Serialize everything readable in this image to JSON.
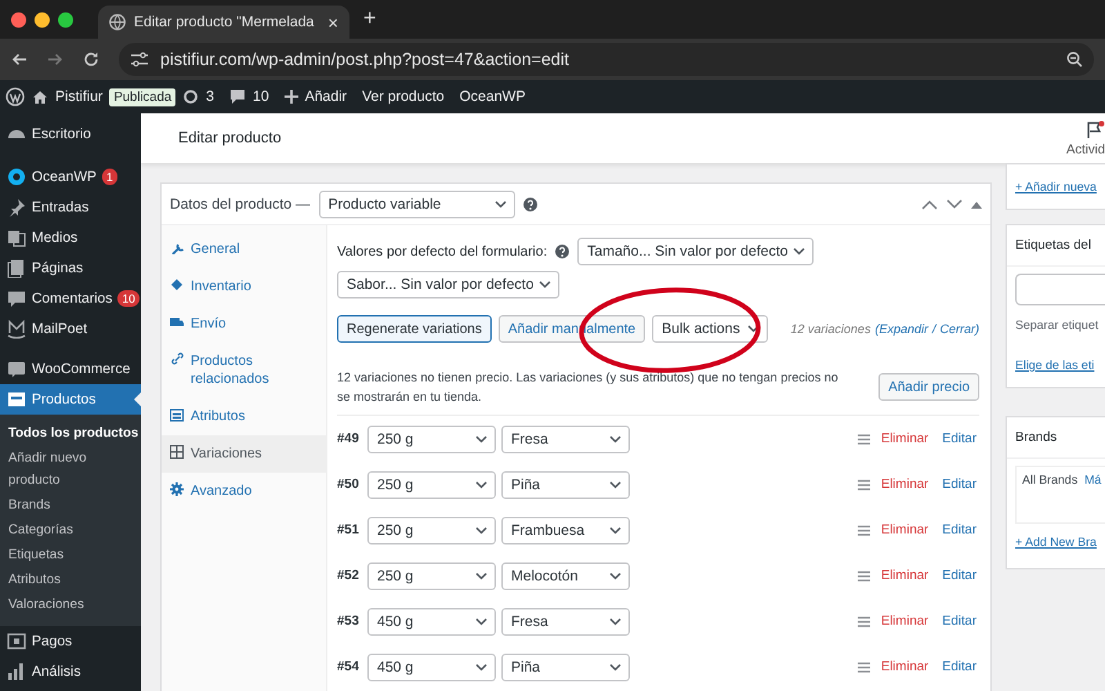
{
  "browser": {
    "tab_title": "Editar producto \"Mermelada",
    "close": "×",
    "new_tab": "+",
    "url": "pistifiur.com/wp-admin/post.php?post=47&action=edit"
  },
  "admin_bar": {
    "site": "Pistifiur",
    "status_badge": "Publicada",
    "updates": "3",
    "comments": "10",
    "add": "Añadir",
    "links": [
      "Ver producto",
      "OceanWP"
    ]
  },
  "sidebar": {
    "items": [
      {
        "label": "Escritorio",
        "selected": false
      },
      {
        "label": "OceanWP",
        "badge": "1",
        "selected": false
      },
      {
        "label": "Entradas",
        "selected": false
      },
      {
        "label": "Medios",
        "selected": false
      },
      {
        "label": "Páginas",
        "selected": false
      },
      {
        "label": "Comentarios",
        "badge": "10",
        "selected": false
      },
      {
        "label": "MailPoet",
        "selected": false
      },
      {
        "label": "WooCommerce",
        "selected": false
      },
      {
        "label": "Productos",
        "selected": true,
        "children": [
          {
            "label": "Todos los productos",
            "selected": true
          },
          {
            "label": "Añadir nuevo producto",
            "selected": false
          },
          {
            "label": "Brands",
            "selected": false
          },
          {
            "label": "Categorías",
            "selected": false
          },
          {
            "label": "Etiquetas",
            "selected": false
          },
          {
            "label": "Atributos",
            "selected": false
          },
          {
            "label": "Valoraciones",
            "selected": false
          }
        ]
      },
      {
        "label": "Pagos",
        "selected": false
      },
      {
        "label": "Análisis",
        "selected": false
      }
    ]
  },
  "header": {
    "title": "Editar producto",
    "activity": "Activid"
  },
  "product_data": {
    "title": "Datos del producto —",
    "type_select": "Producto variable",
    "tabs": [
      {
        "label": "General",
        "selected": false
      },
      {
        "label": "Inventario",
        "selected": false
      },
      {
        "label": "Envío",
        "selected": false
      },
      {
        "label": "Productos relacionados",
        "selected": false
      },
      {
        "label": "Atributos",
        "selected": false
      },
      {
        "label": "Variaciones",
        "selected": true
      },
      {
        "label": "Avanzado",
        "selected": false
      }
    ],
    "defaults_label": "Valores por defecto del formulario:",
    "default_selects": [
      "Tamaño... Sin valor por defecto",
      "Sabor... Sin valor por defecto"
    ],
    "buttons": [
      "Regenerate variations",
      "Añadir manualmente"
    ],
    "bulk_select": "Bulk actions",
    "count": "12 variaciones",
    "expand": "(Expandir",
    "separator": "/",
    "collapse": "Cerrar)",
    "notice": "12 variaciones no tienen precio. Las variaciones (y sus atributos) que no tengan precios no se mostrarán en tu tienda.",
    "add_price": "Añadir precio",
    "variations": [
      {
        "id": "#49",
        "size": "250 g",
        "flavor": "Fresa",
        "delete": "Eliminar",
        "edit": "Editar"
      },
      {
        "id": "#50",
        "size": "250 g",
        "flavor": "Piña",
        "delete": "Eliminar",
        "edit": "Editar"
      },
      {
        "id": "#51",
        "size": "250 g",
        "flavor": "Frambuesa",
        "delete": "Eliminar",
        "edit": "Editar"
      },
      {
        "id": "#52",
        "size": "250 g",
        "flavor": "Melocotón",
        "delete": "Eliminar",
        "edit": "Editar"
      },
      {
        "id": "#53",
        "size": "450 g",
        "flavor": "Fresa",
        "delete": "Eliminar",
        "edit": "Editar"
      },
      {
        "id": "#54",
        "size": "450 g",
        "flavor": "Piña",
        "delete": "Eliminar",
        "edit": "Editar"
      }
    ]
  },
  "side_boxes": [
    {
      "kind": "link",
      "link": "+ Añadir nueva"
    },
    {
      "kind": "tags",
      "title": "Etiquetas del",
      "hint": "Separar etiquet",
      "link": "Elige de las eti"
    },
    {
      "kind": "brands",
      "title": "Brands",
      "tabs": [
        {
          "label": "All Brands",
          "selected": true
        },
        {
          "label": "Má",
          "selected": false
        }
      ],
      "link": "+ Add New Bra"
    }
  ]
}
